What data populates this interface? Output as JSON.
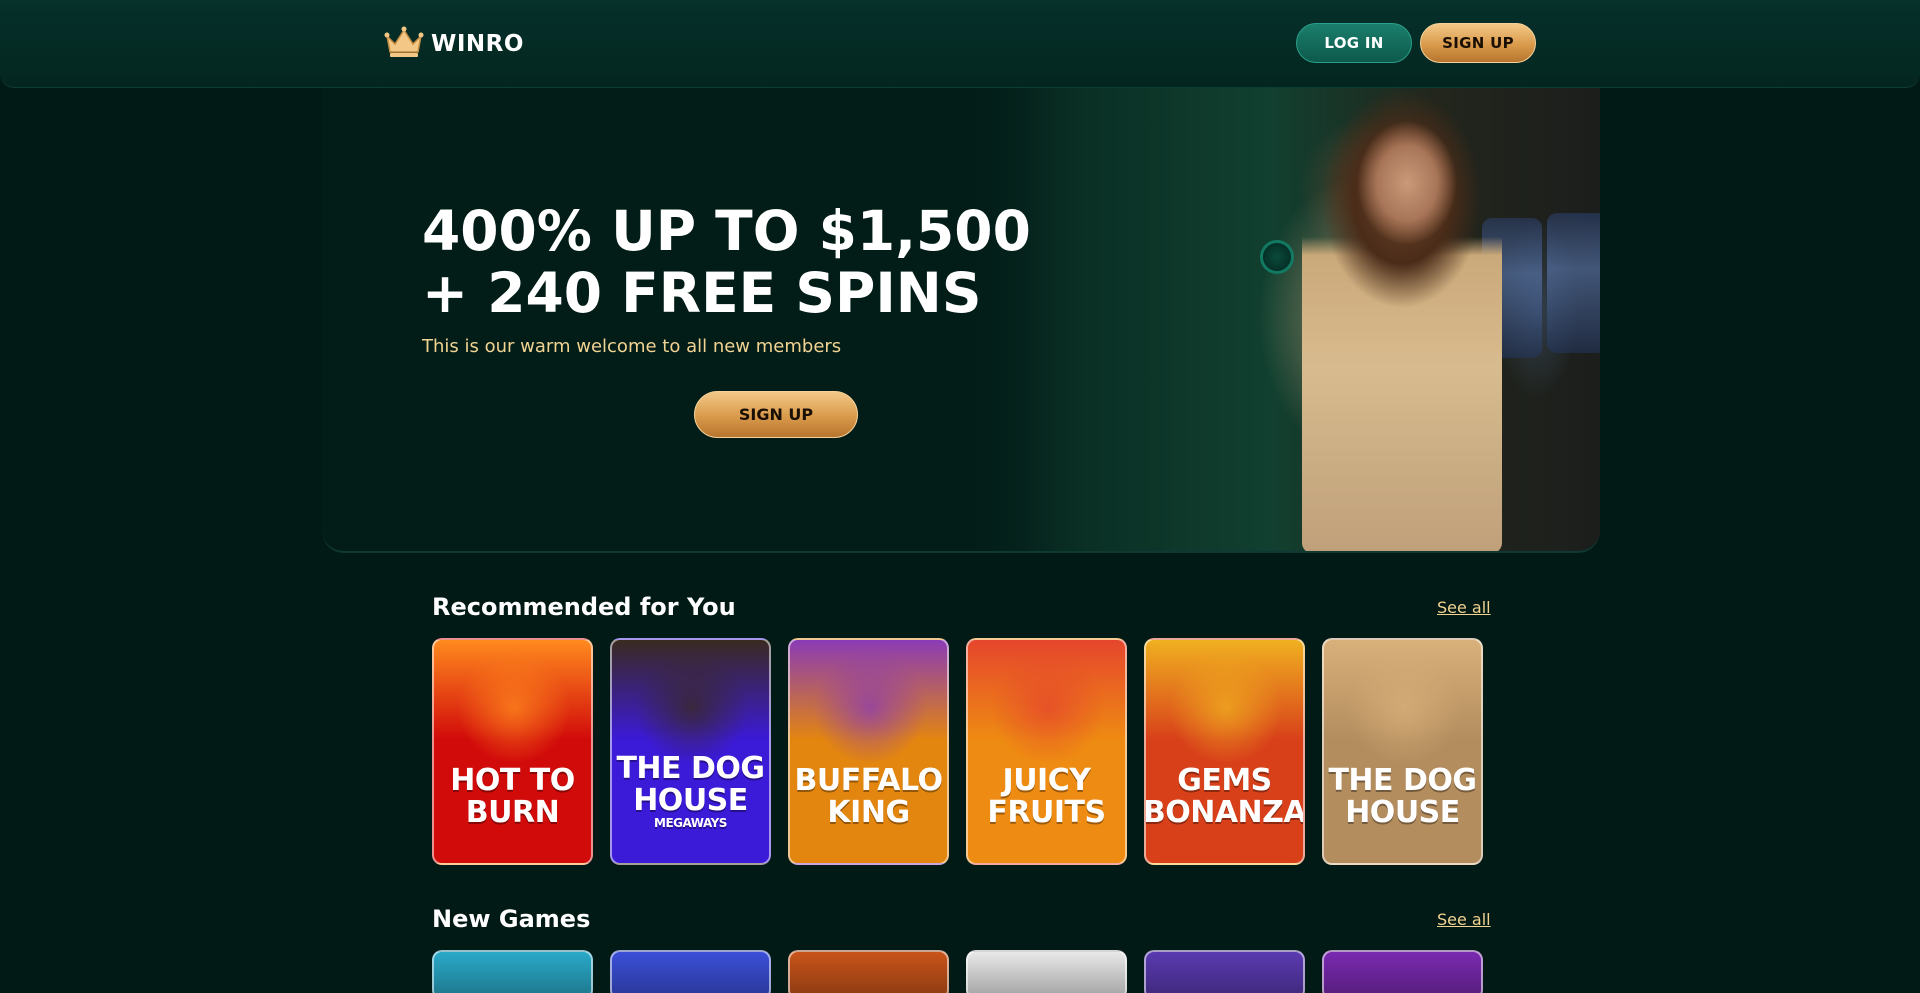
{
  "header": {
    "logo_text": "WINRO",
    "login_label": "LOG IN",
    "signup_label": "SIGN UP"
  },
  "hero": {
    "title_line1": "400% UP TO $1,500",
    "title_line2": "+ 240 FREE SPINS",
    "subtitle": "This is our warm welcome to all new members",
    "cta_label": "SIGN UP"
  },
  "recommended": {
    "title": "Recommended for You",
    "see_all": "See all",
    "games": [
      {
        "line1": "HOT TO",
        "line2": "BURN",
        "extra": "",
        "bg": "#d10a0a",
        "art": "#ff8a1e"
      },
      {
        "line1": "THE DOG",
        "line2": "HOUSE",
        "extra": "MEGAWAYS",
        "bg": "#3b1ad8",
        "art": "#3a2a20"
      },
      {
        "line1": "BUFFALO",
        "line2": "KING",
        "extra": "",
        "bg": "#e3860f",
        "art": "#8a3bb5"
      },
      {
        "line1": "JUICY",
        "line2": "FRUITS",
        "extra": "",
        "bg": "#ee8b12",
        "art": "#e5462c"
      },
      {
        "line1": "GEMS",
        "line2": "BONANZA",
        "extra": "",
        "bg": "#d8401a",
        "art": "#f0b020"
      },
      {
        "line1": "THE DOG",
        "line2": "HOUSE",
        "extra": "",
        "bg": "#b48d5f",
        "art": "#d8b07a"
      }
    ]
  },
  "new_games": {
    "title": "New Games",
    "see_all": "See all",
    "tile_colors": [
      "#2aa9c8",
      "#3b4fd8",
      "#c8541a",
      "#e8e8e8",
      "#5a3ab0",
      "#7a2ab0"
    ]
  },
  "colors": {
    "accent_gold": "#f1d392",
    "bg": "#021a16",
    "login_green": "#1b7e6c"
  }
}
